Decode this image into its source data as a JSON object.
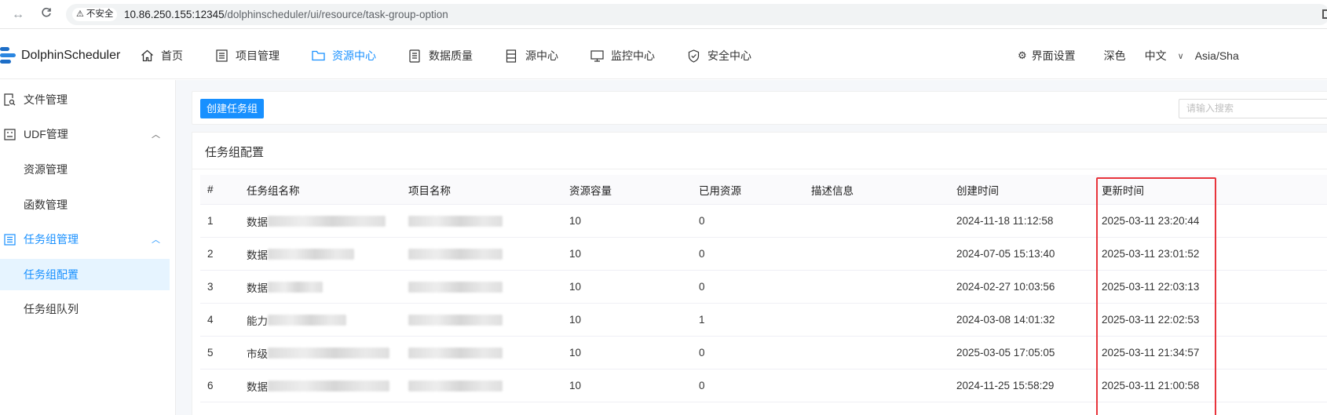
{
  "browser": {
    "security_label": "不安全",
    "url_host": "10.86.250.155:12345",
    "url_path": "/dolphinscheduler/ui/resource/task-group-option"
  },
  "header": {
    "brand": "DolphinScheduler",
    "menu": [
      {
        "label": "首页",
        "icon": "home-icon"
      },
      {
        "label": "项目管理",
        "icon": "project-icon"
      },
      {
        "label": "资源中心",
        "icon": "folder-icon",
        "active": true
      },
      {
        "label": "数据质量",
        "icon": "quality-icon"
      },
      {
        "label": "源中心",
        "icon": "datasource-icon"
      },
      {
        "label": "监控中心",
        "icon": "monitor-icon"
      },
      {
        "label": "安全中心",
        "icon": "shield-icon"
      }
    ],
    "settings_label": "界面设置",
    "theme_label": "深色",
    "language_label": "中文",
    "timezone_label": "Asia/Sha"
  },
  "sidebar": {
    "items": [
      {
        "label": "文件管理"
      },
      {
        "label": "UDF管理"
      },
      {
        "label": "资源管理"
      },
      {
        "label": "函数管理"
      },
      {
        "label": "任务组管理"
      },
      {
        "label": "任务组配置"
      },
      {
        "label": "任务组队列"
      }
    ]
  },
  "toolbar": {
    "create_label": "创建任务组",
    "search_placeholder": "请输入搜索"
  },
  "table": {
    "title": "任务组配置",
    "columns": [
      "#",
      "任务组名称",
      "项目名称",
      "资源容量",
      "已用资源",
      "描述信息",
      "创建时间",
      "更新时间"
    ],
    "rows": [
      {
        "idx": "1",
        "name": "数据",
        "capacity": "10",
        "used": "0",
        "created": "2024-11-18 11:12:58",
        "updated": "2025-03-11 23:20:44"
      },
      {
        "idx": "2",
        "name": "数据",
        "capacity": "10",
        "used": "0",
        "created": "2024-07-05 15:13:40",
        "updated": "2025-03-11 23:01:52"
      },
      {
        "idx": "3",
        "name": "数据",
        "capacity": "10",
        "used": "0",
        "created": "2024-02-27 10:03:56",
        "updated": "2025-03-11 22:03:13"
      },
      {
        "idx": "4",
        "name": "能力",
        "capacity": "10",
        "used": "1",
        "created": "2024-03-08 14:01:32",
        "updated": "2025-03-11 22:02:53"
      },
      {
        "idx": "5",
        "name": "市级",
        "capacity": "10",
        "used": "0",
        "created": "2025-03-05 17:05:05",
        "updated": "2025-03-11 21:34:57"
      },
      {
        "idx": "6",
        "name": "数据",
        "capacity": "10",
        "used": "0",
        "created": "2024-11-25 15:58:29",
        "updated": "2025-03-11 21:00:58"
      }
    ]
  },
  "colors": {
    "accent": "#1890ff",
    "highlight_border": "#e8343c",
    "selected_bg": "#e6f4ff"
  }
}
